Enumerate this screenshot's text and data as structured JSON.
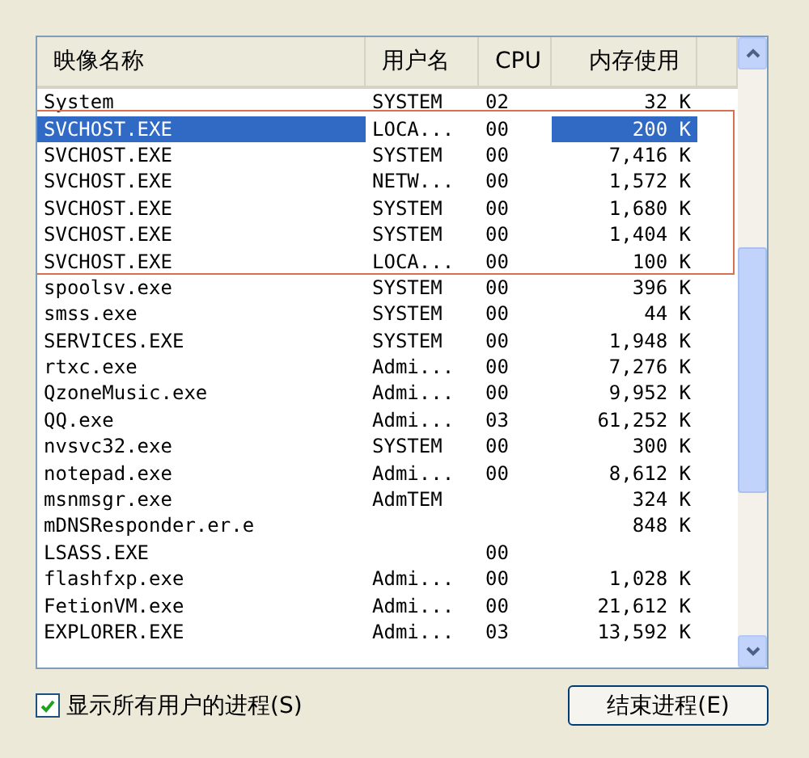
{
  "table": {
    "columns": [
      "映像名称",
      "用户名",
      "CPU",
      "内存使用"
    ],
    "rows": [
      {
        "name": "System",
        "user": "SYSTEM",
        "cpu": "02",
        "mem": "32 K",
        "selected": false
      },
      {
        "name": "SVCHOST.EXE",
        "user": "LOCA...",
        "cpu": "00",
        "mem": "200 K",
        "selected": true
      },
      {
        "name": "SVCHOST.EXE",
        "user": "SYSTEM",
        "cpu": "00",
        "mem": "7,416 K",
        "selected": false
      },
      {
        "name": "SVCHOST.EXE",
        "user": "NETW...",
        "cpu": "00",
        "mem": "1,572 K",
        "selected": false
      },
      {
        "name": "SVCHOST.EXE",
        "user": "SYSTEM",
        "cpu": "00",
        "mem": "1,680 K",
        "selected": false
      },
      {
        "name": "SVCHOST.EXE",
        "user": "SYSTEM",
        "cpu": "00",
        "mem": "1,404 K",
        "selected": false
      },
      {
        "name": "SVCHOST.EXE",
        "user": "LOCA...",
        "cpu": "00",
        "mem": "100 K",
        "selected": false
      },
      {
        "name": "spoolsv.exe",
        "user": "SYSTEM",
        "cpu": "00",
        "mem": "396 K",
        "selected": false
      },
      {
        "name": "smss.exe",
        "user": "SYSTEM",
        "cpu": "00",
        "mem": "44 K",
        "selected": false
      },
      {
        "name": "SERVICES.EXE",
        "user": "SYSTEM",
        "cpu": "00",
        "mem": "1,948 K",
        "selected": false
      },
      {
        "name": "rtxc.exe",
        "user": "Admi...",
        "cpu": "00",
        "mem": "7,276 K",
        "selected": false
      },
      {
        "name": "QzoneMusic.exe",
        "user": "Admi...",
        "cpu": "00",
        "mem": "9,952 K",
        "selected": false
      },
      {
        "name": "QQ.exe",
        "user": "Admi...",
        "cpu": "03",
        "mem": "61,252 K",
        "selected": false
      },
      {
        "name": "nvsvc32.exe",
        "user": "SYSTEM",
        "cpu": "00",
        "mem": "300 K",
        "selected": false
      },
      {
        "name": "notepad.exe",
        "user": "Admi...",
        "cpu": "00",
        "mem": "8,612 K",
        "selected": false
      },
      {
        "name": "msnmsgr.exe",
        "user": "AdmTEM",
        "mem": "324 K",
        "selected": false
      },
      {
        "name": "mDNSResponder.er.e",
        "mem": "848 K",
        "selected": false
      },
      {
        "name": "LSASS.EXE",
        "cpu": "00",
        "selected": false
      },
      {
        "name": "flashfxp.exe",
        "user": "Admi...",
        "cpu": "00",
        "mem": "1,028 K",
        "selected": false
      },
      {
        "name": "FetionVM.exe",
        "user": "Admi...",
        "cpu": "00",
        "mem": "21,612 K",
        "selected": false
      },
      {
        "name": "EXPLORER.EXE",
        "user": "Admi...",
        "cpu": "03",
        "mem": "13,592 K",
        "selected": false
      }
    ]
  },
  "show_all_users": {
    "label": "显示所有用户的进程(S)",
    "checked": true
  },
  "end_button": {
    "label": "结束进程(E)"
  }
}
